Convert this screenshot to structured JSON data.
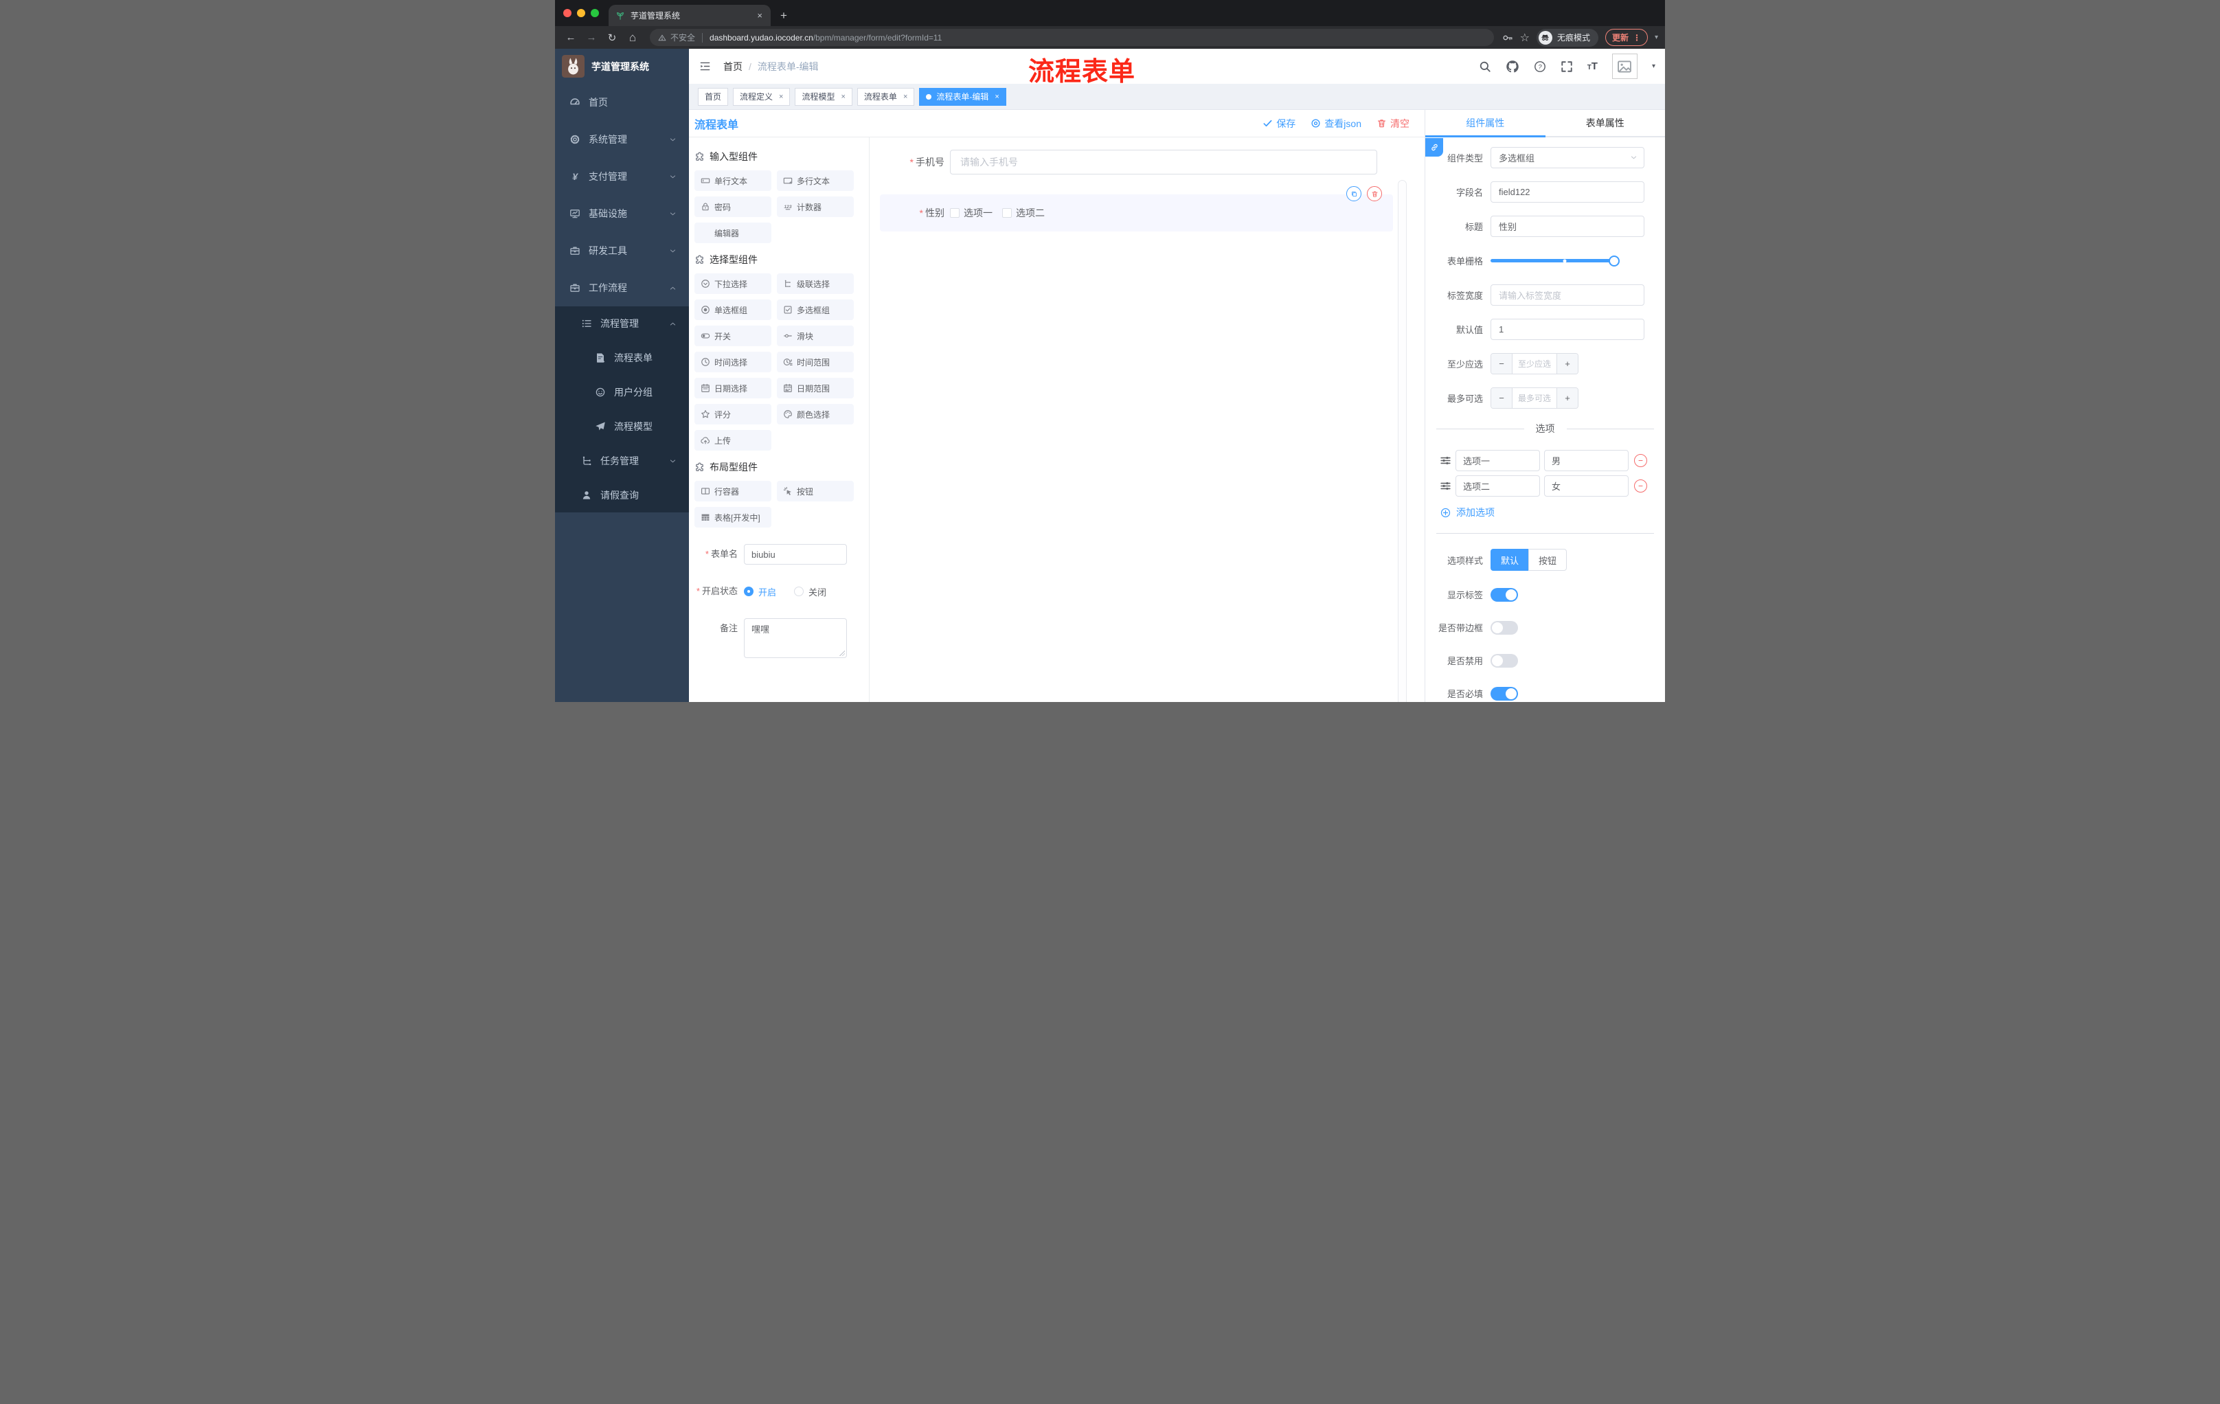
{
  "colors": {
    "accent": "#409eff",
    "danger": "#f56c6c",
    "annotation_red": "#fb2818",
    "sidebar_bg": "#304156",
    "submenu_bg": "#1f2d3d",
    "active_tab_bg": "#409eff"
  },
  "browser": {
    "tab_title": "芋道管理系统",
    "tab_favicon": "seedling-icon",
    "close_tab": "×",
    "new_tab": "+",
    "security_label": "不安全",
    "url_host": "dashboard.yudao.iocoder.cn",
    "url_path": "/bpm/manager/form/edit?formId=11",
    "incognito_label": "无痕模式",
    "update_label": "更新",
    "menu_dots": "⋮",
    "back": "←",
    "forward": "→",
    "reload": "↻",
    "home": "⌂",
    "star": "☆",
    "caret": "▾"
  },
  "sidebar": {
    "brand": "芋道管理系统",
    "items": [
      {
        "icon": "dashboard-icon",
        "label": "首页",
        "level": 1
      },
      {
        "icon": "gear-icon",
        "label": "系统管理",
        "level": 1,
        "chevron": "down"
      },
      {
        "icon": "yen-icon",
        "label": "支付管理",
        "level": 1,
        "chevron": "down"
      },
      {
        "icon": "monitor-icon",
        "label": "基础设施",
        "level": 1,
        "chevron": "down"
      },
      {
        "icon": "toolbox-icon",
        "label": "研发工具",
        "level": 1,
        "chevron": "down"
      },
      {
        "icon": "briefcase-icon",
        "label": "工作流程",
        "level": 1,
        "chevron": "up"
      }
    ],
    "submenu": [
      {
        "icon": "flow-list-icon",
        "label": "流程管理",
        "level": 2,
        "chevron": "up"
      },
      {
        "icon": "doc-edit-icon",
        "label": "流程表单",
        "level": 3
      },
      {
        "icon": "face-icon",
        "label": "用户分组",
        "level": 3
      },
      {
        "icon": "plane-icon",
        "label": "流程模型",
        "level": 3
      },
      {
        "icon": "tree-icon",
        "label": "任务管理",
        "level": 2,
        "chevron": "down"
      },
      {
        "icon": "person-icon",
        "label": "请假查询",
        "level": 2
      }
    ]
  },
  "header": {
    "breadcrumb_home": "首页",
    "breadcrumb_sep": "/",
    "breadcrumb_current": "流程表单-编辑",
    "annotation": "流程表单",
    "fontsize_small": "T",
    "fontsize_large": "T",
    "caret": "▾"
  },
  "route_tabs": [
    {
      "label": "首页",
      "closable": false,
      "active": false
    },
    {
      "label": "流程定义",
      "closable": true,
      "active": false
    },
    {
      "label": "流程模型",
      "closable": true,
      "active": false
    },
    {
      "label": "流程表单",
      "closable": true,
      "active": false
    },
    {
      "label": "流程表单-编辑",
      "closable": true,
      "active": true
    }
  ],
  "left_panel": {
    "title": "流程表单",
    "sections": [
      {
        "title": "输入型组件",
        "icon": "puzzle-icon",
        "items": [
          {
            "icon": "input-icon",
            "label": "单行文本"
          },
          {
            "icon": "textarea-icon",
            "label": "多行文本"
          },
          {
            "icon": "lock-icon",
            "label": "密码"
          },
          {
            "icon": "counter-icon",
            "label": "计数器"
          },
          {
            "icon": "",
            "label": "编辑器"
          }
        ]
      },
      {
        "title": "选择型组件",
        "icon": "puzzle-icon",
        "items": [
          {
            "icon": "select-icon",
            "label": "下拉选择"
          },
          {
            "icon": "cascader-icon",
            "label": "级联选择"
          },
          {
            "icon": "radio-icon",
            "label": "单选框组"
          },
          {
            "icon": "checkbox-icon",
            "label": "多选框组"
          },
          {
            "icon": "switch-icon",
            "label": "开关"
          },
          {
            "icon": "slider-icon",
            "label": "滑块"
          },
          {
            "icon": "time-icon",
            "label": "时间选择"
          },
          {
            "icon": "time-range-icon",
            "label": "时间范围"
          },
          {
            "icon": "date-icon",
            "label": "日期选择"
          },
          {
            "icon": "date-range-icon",
            "label": "日期范围"
          },
          {
            "icon": "star-icon",
            "label": "评分"
          },
          {
            "icon": "palette-icon",
            "label": "颜色选择"
          },
          {
            "icon": "upload-icon",
            "label": "上传"
          }
        ]
      },
      {
        "title": "布局型组件",
        "icon": "puzzle-icon",
        "items": [
          {
            "icon": "columns-icon",
            "label": "行容器"
          },
          {
            "icon": "click-icon",
            "label": "按钮"
          },
          {
            "icon": "table-icon",
            "label": "表格[开发中]"
          }
        ]
      }
    ],
    "form": {
      "name_label": "表单名",
      "name_value": "biubiu",
      "status_label": "开启状态",
      "status_on": "开启",
      "status_off": "关闭",
      "remark_label": "备注",
      "remark_value": "嘿嘿"
    }
  },
  "canvas": {
    "toolbar": {
      "save": "保存",
      "view_json": "查看json",
      "clear": "清空"
    },
    "phone_field": {
      "label": "手机号",
      "required": true,
      "placeholder": "请输入手机号"
    },
    "gender_field": {
      "label": "性别",
      "required": true,
      "options": [
        "选项一",
        "选项二"
      ]
    }
  },
  "props_panel": {
    "tabs": [
      {
        "label": "组件属性",
        "active": true
      },
      {
        "label": "表单属性",
        "active": false
      }
    ],
    "rows": [
      {
        "label": "组件类型",
        "kind": "select",
        "value": "多选框组"
      },
      {
        "label": "字段名",
        "kind": "input",
        "value": "field122"
      },
      {
        "label": "标题",
        "kind": "input",
        "value": "性别"
      },
      {
        "label": "表单栅格",
        "kind": "slider",
        "fill_percent": 100,
        "mark_percent": 60
      },
      {
        "label": "标签宽度",
        "kind": "input",
        "placeholder": "请输入标签宽度"
      },
      {
        "label": "默认值",
        "kind": "input",
        "value": "1"
      },
      {
        "label": "至少应选",
        "kind": "stepper",
        "placeholder": "至少应选"
      },
      {
        "label": "最多可选",
        "kind": "stepper",
        "placeholder": "最多可选"
      }
    ],
    "options_divider": "选项",
    "options": [
      {
        "label": "选项一",
        "value": "男"
      },
      {
        "label": "选项二",
        "value": "女"
      }
    ],
    "add_option": "添加选项",
    "style_label": "选项样式",
    "style_options": [
      {
        "label": "默认",
        "active": true
      },
      {
        "label": "按钮",
        "active": false
      }
    ],
    "switches": [
      {
        "label": "显示标签",
        "on": true
      },
      {
        "label": "是否带边框",
        "on": false
      },
      {
        "label": "是否禁用",
        "on": false
      },
      {
        "label": "是否必填",
        "on": true
      }
    ]
  }
}
